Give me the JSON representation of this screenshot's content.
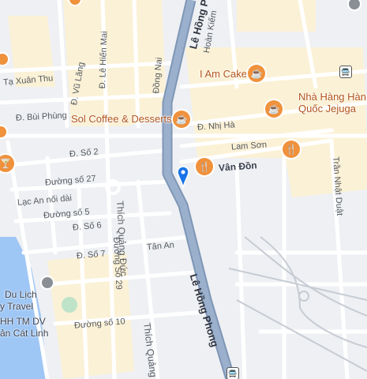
{
  "colors": {
    "road_main": "#8fa6c4",
    "road_minor": "#ffffff",
    "water": "#9fc7f5",
    "block_tan": "#fbf1d6",
    "poi_orange": "#f0913c",
    "marker_blue": "#1a73e8"
  },
  "streets": {
    "le_hong_phong_top": "Lê Hồng Ph",
    "le_hong_phong_bottom": "Lê Hồng Phong",
    "ta_xuan_thu": "Tạ Xuân Thu",
    "le_hien_mai": "Đ. Lê Hiến Mai",
    "vu_lang": "Đ. Vũ Lăng",
    "dong_nai": "Đồng Nai",
    "hoan_kiem": "Hoàn Kiếm",
    "bui_phung": "Đ. Bùi Phùng",
    "nhi_ha": "Đ. Nhị Hà",
    "lam_son": "Lam Sơn",
    "van_don": "Vân Đồn",
    "so_2": "Đ. Số 2",
    "duong_so_27": "Đường số 27",
    "lac_an": "Lạc An nối dài",
    "duong_so_5": "Đường số 5",
    "so_6": "Đ. Số 6",
    "so_7": "Đ. Số 7",
    "tan_an": "Tân An",
    "thich_quang_duc": "Thích Quảng Đức",
    "duong_so_29": "Đường Số 29",
    "duong_so_10": "Đường số 10",
    "thich_quang_bottom": "Thích Quảng Đ",
    "tran_nhat_duat": "Trần Nhật Duật"
  },
  "places": {
    "i_am_cake": "I Am Cake",
    "sol_coffee": "Sol Coffee & Desserts",
    "nha_hang_line1": "Nhà Hàng Hàn",
    "nha_hang_line2": "Quốc Jejuga",
    "du_lich": "Du Lịch",
    "y_travel": "y Travel",
    "hh_tm_dv": "HH TM DV",
    "an_cat_linh": "ản Cát Linh"
  },
  "icons": {
    "cafe": "☕",
    "restaurant": "🍴",
    "cocktail": "🍸",
    "bus": "🚍"
  }
}
